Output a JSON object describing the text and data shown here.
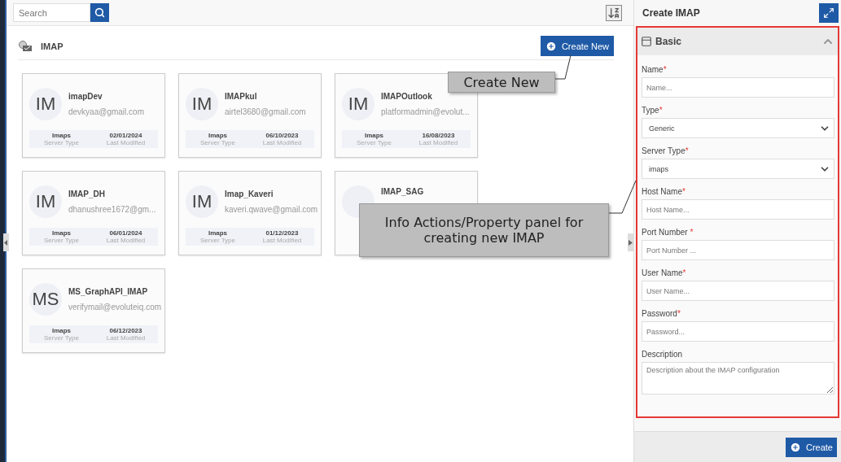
{
  "search": {
    "placeholder": "Search"
  },
  "section": {
    "title": "IMAP",
    "create_button": "Create New"
  },
  "cards": [
    {
      "initials": "IM",
      "name": "imapDev",
      "email": "devkyaa@gmail.com",
      "server_type": "Imaps",
      "server_type_label": "Server Type",
      "modified": "02/01/2024",
      "modified_label": "Last Modified"
    },
    {
      "initials": "IM",
      "name": "IMAPkul",
      "email": "airtel3680@gmail.com",
      "server_type": "Imaps",
      "server_type_label": "Server Type",
      "modified": "06/10/2023",
      "modified_label": "Last Modified"
    },
    {
      "initials": "IM",
      "name": "IMAPOutlook",
      "email": "platformadmin@evolut...",
      "server_type": "Imaps",
      "server_type_label": "Server Type",
      "modified": "16/08/2023",
      "modified_label": "Last Modified"
    },
    {
      "initials": "IM",
      "name": "IMAP_DH",
      "email": "dhanushree1672@gm...",
      "server_type": "Imaps",
      "server_type_label": "Server Type",
      "modified": "06/01/2024",
      "modified_label": "Last Modified"
    },
    {
      "initials": "IM",
      "name": "Imap_Kaveri",
      "email": "kaveri.qwave@gmail.com",
      "server_type": "Imaps",
      "server_type_label": "Server Type",
      "modified": "01/12/2023",
      "modified_label": "Last Modified"
    },
    {
      "name": "IMAP_SAG"
    },
    {
      "initials": "MS",
      "name": "MS_GraphAPI_IMAP",
      "email": "verifymail@evoluteiq.com",
      "server_type": "Imaps",
      "server_type_label": "Server Type",
      "modified": "06/12/2023",
      "modified_label": "Last Modified"
    }
  ],
  "callouts": [
    {
      "text": "Create New",
      "kind": "small"
    },
    {
      "text": "Info Actions/Property panel for creating new IMAP",
      "kind": "large"
    }
  ],
  "panel": {
    "title": "Create IMAP",
    "section_title": "Basic",
    "expanded": true,
    "fields": [
      {
        "kind": "text",
        "label": "Name",
        "required_mark": "*",
        "placeholder": "Name..."
      },
      {
        "kind": "select",
        "label": "Type",
        "required_mark": "*",
        "value": "Generic"
      },
      {
        "kind": "select",
        "label": "Server Type",
        "required_mark": "*",
        "value": "imaps"
      },
      {
        "kind": "text",
        "label": "Host Name",
        "required_mark": "*",
        "placeholder": "Host Name..."
      },
      {
        "kind": "text",
        "label": "Port Number ",
        "required_mark": "*",
        "placeholder": "Port Number ..."
      },
      {
        "kind": "text",
        "label": "User Name",
        "required_mark": "*",
        "placeholder": "User Name..."
      },
      {
        "kind": "text",
        "label": "Password",
        "required_mark": "*",
        "placeholder": "Password..."
      },
      {
        "kind": "textarea",
        "label": "Description",
        "placeholder": "Description about the IMAP configuration"
      }
    ],
    "create_button": "Create"
  }
}
